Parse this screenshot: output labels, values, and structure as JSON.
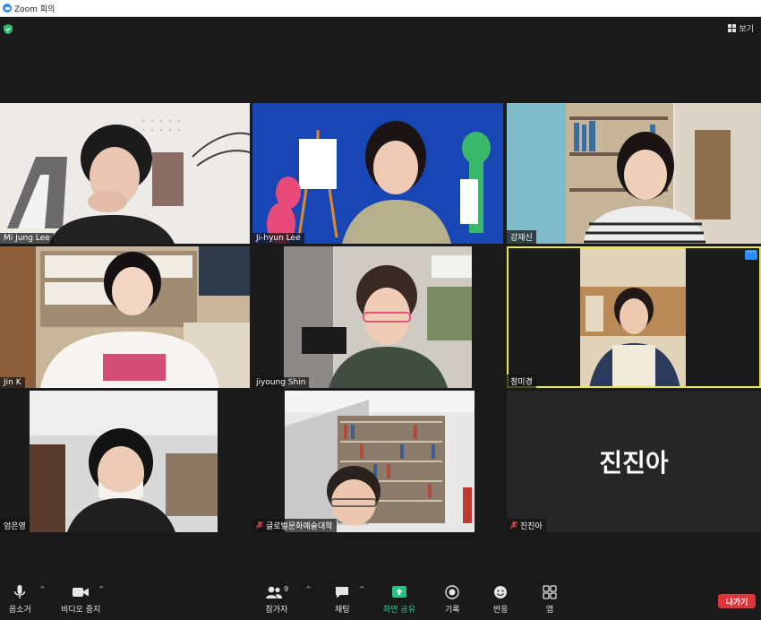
{
  "window": {
    "title": "Zoom 회의"
  },
  "top": {
    "view_label": "보기"
  },
  "participants": [
    {
      "name": "Mi Jung Lee",
      "muted": false
    },
    {
      "name": "Ji-hyun Lee",
      "muted": false
    },
    {
      "name": "강재신",
      "muted": false
    },
    {
      "name": "Jin K",
      "muted": false
    },
    {
      "name": "jiyoung Shin",
      "muted": false
    },
    {
      "name": "정미경",
      "muted": false,
      "active": true
    },
    {
      "name": "엄은영",
      "muted": false
    },
    {
      "name": "글로벌문화예술대학",
      "muted": true
    },
    {
      "name": "진진아",
      "muted": true,
      "video_off": true
    }
  ],
  "toolbar": {
    "audio_label": "음소거",
    "video_label": "비디오 중지",
    "participants_label": "참가자",
    "participants_count": "9",
    "chat_label": "채팅",
    "share_label": "화면 공유",
    "record_label": "기록",
    "reactions_label": "반응",
    "apps_label": "앱",
    "leave_label": "나가기"
  },
  "colors": {
    "active_speaker": "#e6e84a",
    "share_green": "#26c281",
    "leave_red": "#d9363e",
    "accent_blue": "#2d8cff"
  }
}
